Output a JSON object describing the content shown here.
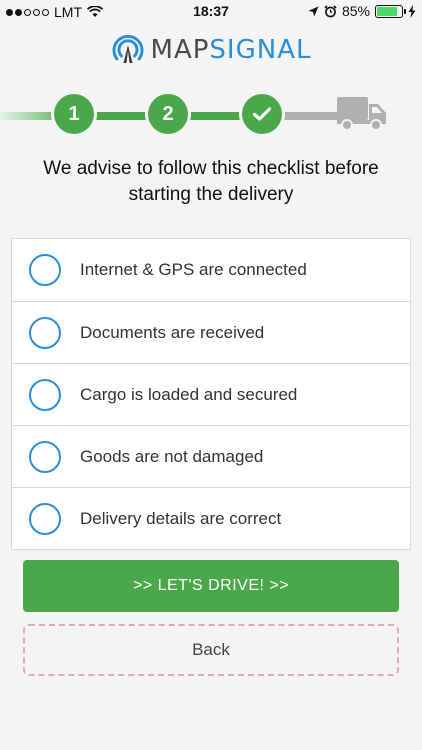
{
  "status_bar": {
    "carrier": "LMT",
    "time": "18:37",
    "battery": "85%",
    "battery_level": 0.85
  },
  "logo": {
    "map": "MAP",
    "signal": "SIGNAL"
  },
  "stepper": {
    "step1": "1",
    "step2": "2",
    "step3_icon": "checkmark-icon",
    "final_icon": "truck-icon",
    "colors": {
      "done": "#4aa84a",
      "pending": "#b0b0b0"
    }
  },
  "heading": {
    "line1": "We advise to follow this checklist before",
    "line2": "starting the delivery"
  },
  "checklist": {
    "items": [
      {
        "label": "Internet & GPS are connected",
        "checked": false
      },
      {
        "label": "Documents are received",
        "checked": false
      },
      {
        "label": "Cargo is loaded and secured",
        "checked": false
      },
      {
        "label": "Goods are not damaged",
        "checked": false
      },
      {
        "label": "Delivery details are correct",
        "checked": false
      }
    ]
  },
  "buttons": {
    "drive": ">>  LET'S DRIVE!  >>",
    "back": "Back"
  },
  "colors": {
    "accent_green": "#4aa84a",
    "accent_blue": "#2a8fd6",
    "back_border": "#e3a7b5"
  }
}
